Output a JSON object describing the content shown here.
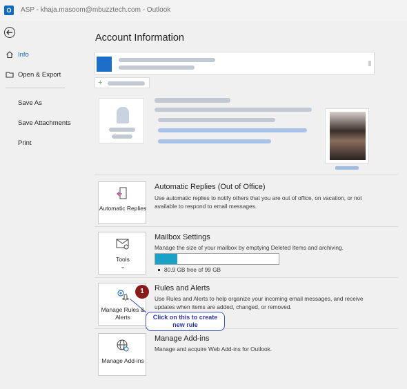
{
  "window": {
    "title_text": "ASP - khaja.masoom@mbuzztech.com  -  Outlook",
    "app_icon_letter": "O"
  },
  "nav": {
    "items": [
      {
        "label": "Info",
        "icon": "home-icon",
        "active": true
      },
      {
        "label": "Open & Export",
        "icon": "folder-open-icon",
        "active": false
      },
      {
        "label": "Save As",
        "icon": "",
        "active": false
      },
      {
        "label": "Save Attachments",
        "icon": "",
        "active": false
      },
      {
        "label": "Print",
        "icon": "",
        "active": false
      }
    ]
  },
  "main": {
    "page_title": "Account Information",
    "sections": [
      {
        "tile_label": "Automatic Replies",
        "tile_icon": "automatic-replies-icon",
        "title": "Automatic Replies (Out of Office)",
        "description": "Use automatic replies to notify others that you are out of office, on vacation, or not available to respond to email messages."
      },
      {
        "tile_label": "Tools",
        "tile_icon": "tools-icon",
        "title": "Mailbox Settings",
        "description": "Manage the size of your mailbox by emptying Deleted Items and archiving.",
        "storage_text": "80.9 GB free of 99 GB",
        "storage_used_fraction": 0.18
      },
      {
        "tile_label": "Manage Rules & Alerts",
        "tile_icon": "rules-alerts-icon",
        "title": "Rules and Alerts",
        "description": "Use Rules and Alerts to help organize your incoming email messages, and receive updates when items are added, changed, or removed."
      },
      {
        "tile_label": "Manage Add-ins",
        "tile_icon": "globe-gear-icon",
        "title": "Manage Add-ins",
        "description": "Manage and acquire Web Add-ins for Outlook."
      }
    ]
  },
  "annotation": {
    "step_number": "1",
    "callout_text": "Click on this to create new rule",
    "color": "#3a4fc5",
    "badge_color": "#8a1a1a"
  },
  "colors": {
    "accent": "#0f6cbd",
    "progress_fill": "#1aa1c7"
  }
}
